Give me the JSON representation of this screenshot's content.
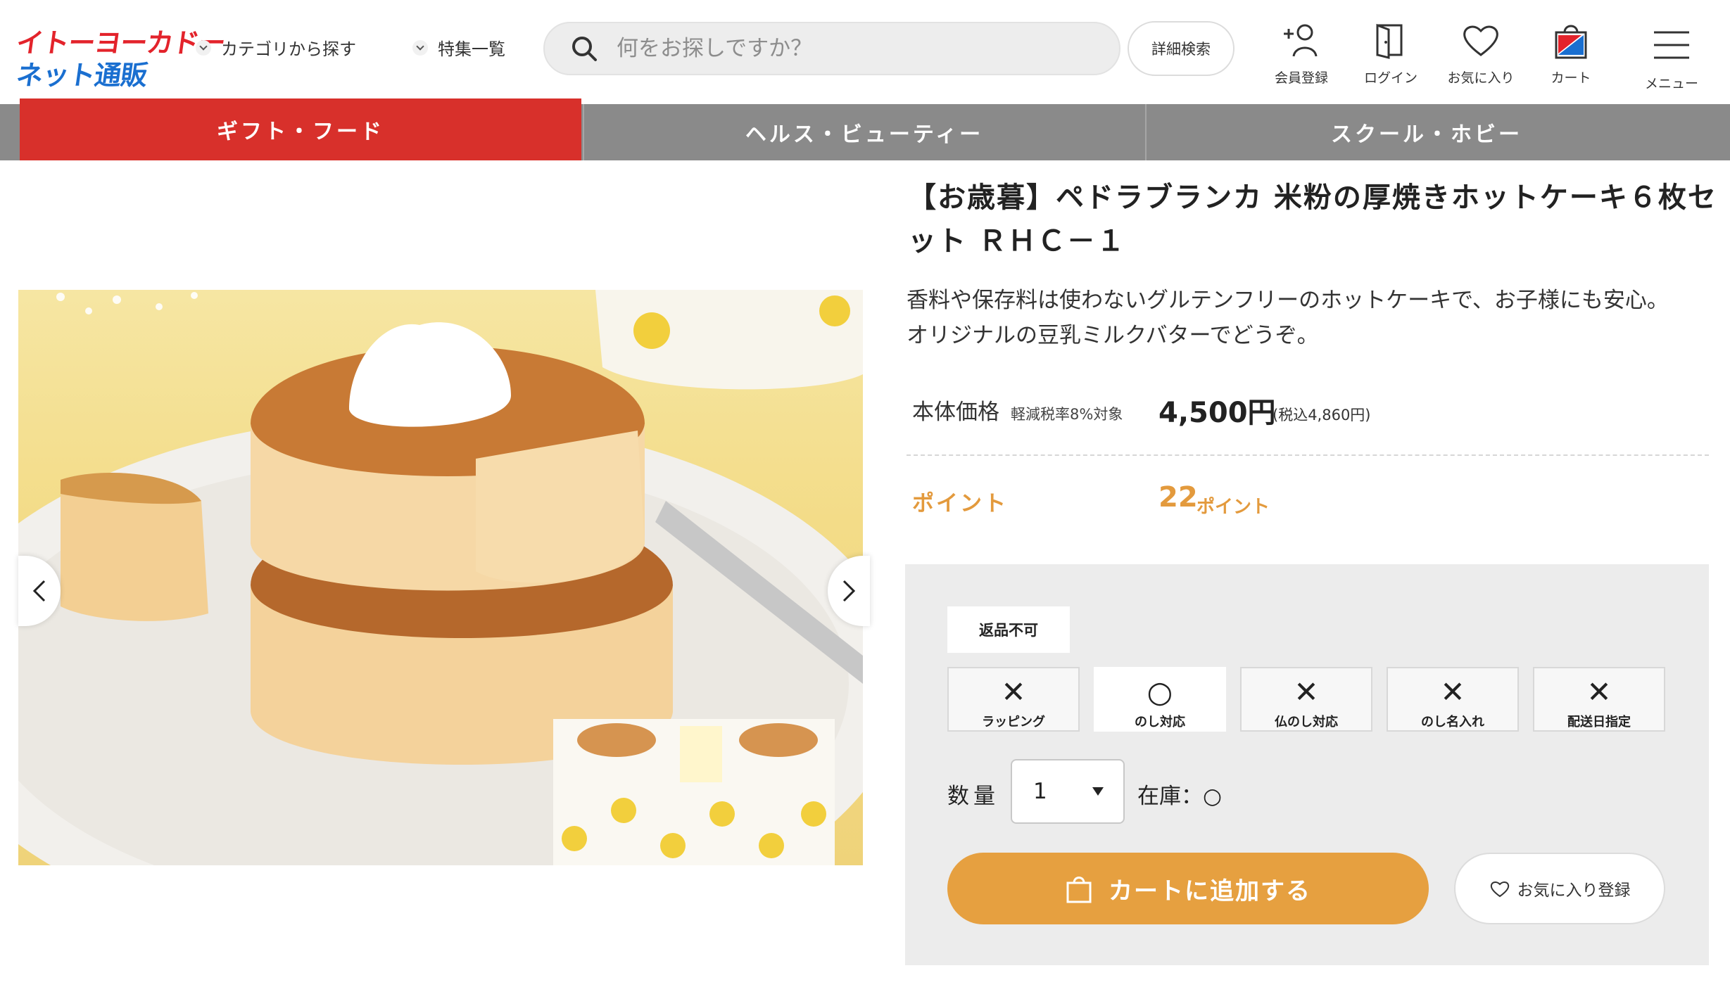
{
  "header": {
    "logo_line1": "イトーヨーカドー",
    "logo_line2": "ネット通販",
    "nav": [
      "カテゴリから探す",
      "特集一覧"
    ],
    "search_placeholder": "何をお探しですか？",
    "detail_search": "詳細検索",
    "icons": [
      {
        "icon": "add-user-icon",
        "label": "会員登録"
      },
      {
        "icon": "login-icon",
        "label": "ログイン"
      },
      {
        "icon": "heart-icon",
        "label": "お気に入り"
      },
      {
        "icon": "cart-icon",
        "label": "カート"
      },
      {
        "icon": "menu-icon",
        "label": "メニュー"
      }
    ]
  },
  "categories": [
    {
      "label": "ギフト・フード",
      "active": true
    },
    {
      "label": "ヘルス・ビューティー",
      "active": false
    },
    {
      "label": "スクール・ホビー",
      "active": false
    }
  ],
  "product": {
    "title": "【お歳暮】ペドラブランカ 米粉の厚焼きホットケーキ６枚セット ＲＨＣ－１",
    "description_lines": [
      "香料や保存料は使わないグルテンフリーのホットケーキで、お子様にも安心。",
      "オリジナルの豆乳ミルクバターでどうぞ。"
    ],
    "price_label": "本体価格",
    "tax_label": "軽減税率8%対象",
    "price": "4,500円",
    "price_tax": "(税込4,860円)",
    "points_label": "ポイント",
    "points_value": "22",
    "points_unit": "ポイント"
  },
  "panel": {
    "badge": "返品不可",
    "options": [
      {
        "mark": "✕",
        "label": "ラッピング",
        "available": false
      },
      {
        "mark": "○",
        "label": "のし対応",
        "available": true
      },
      {
        "mark": "✕",
        "label": "仏のし対応",
        "available": false
      },
      {
        "mark": "✕",
        "label": "のし名入れ",
        "available": false
      },
      {
        "mark": "✕",
        "label": "配送日指定",
        "available": false
      }
    ],
    "qty_label": "数量",
    "qty_value": "1",
    "stock": "在庫：○",
    "cart_button": "カートに追加する",
    "fav_button": "お気に入り登録"
  },
  "colors": {
    "brand_red": "#d8302b",
    "brand_blue": "#1a6fd0",
    "accent_orange": "#e6a040",
    "points_orange": "#e39a3d",
    "category_gray": "#8a8a8a"
  }
}
